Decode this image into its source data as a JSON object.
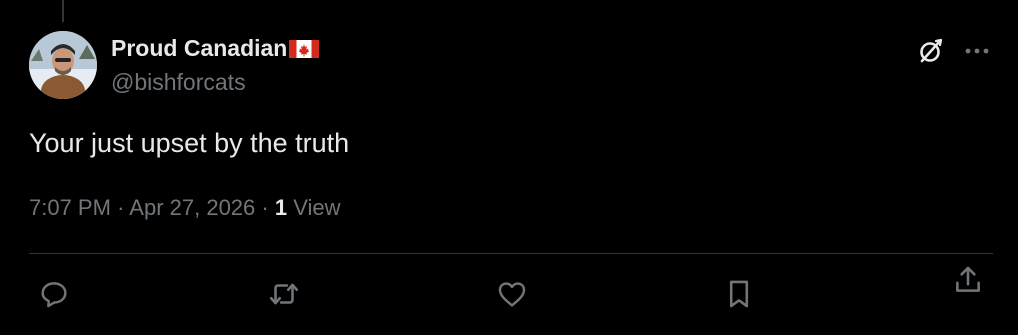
{
  "post": {
    "author": {
      "display_name": "Proud Canadian",
      "flag_icon": "canada-flag-icon",
      "handle": "@bishforcats"
    },
    "text": "Your just upset by the truth",
    "meta": {
      "time": "7:07 PM",
      "separator": "·",
      "date": "Apr 27, 2026",
      "views_count": "1",
      "views_label": "View"
    }
  },
  "actions": [
    "reply-icon",
    "repost-icon",
    "like-icon",
    "bookmark-icon",
    "share-icon"
  ],
  "header_icons": [
    "grok-icon",
    "more-icon"
  ],
  "colors": {
    "background": "#000000",
    "primary_text": "#e7e9ea",
    "secondary_text": "#71767b",
    "divider": "#2f3336",
    "flag_red": "#d52b1e"
  }
}
